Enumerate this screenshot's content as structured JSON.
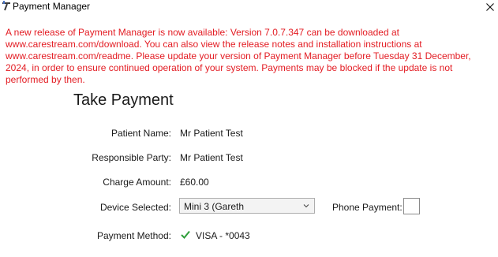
{
  "window": {
    "title": "Payment Manager",
    "app_icon": "payment-manager-app-icon",
    "close_icon": "close-icon"
  },
  "warning": {
    "message": "A new release of Payment Manager is now available: Version 7.0.7.347 can be downloaded at www.carestream.com/download. You can also view the release notes and installation instructions at www.carestream.com/readme. Please update your version of Payment Manager before Tuesday 31 December, 2024, in order to ensure continued operation of your system. Payments may be blocked if the update is not performed by then.",
    "color": "#e31c23"
  },
  "form": {
    "heading": "Take Payment",
    "patient_name": {
      "label": "Patient Name:",
      "value": "Mr Patient Test"
    },
    "responsible_party": {
      "label": "Responsible Party:",
      "value": "Mr Patient Test"
    },
    "charge_amount": {
      "label": "Charge Amount:",
      "value": "£60.00"
    },
    "device_selected": {
      "label": "Device Selected:",
      "value": "Mini 3 (Gareth",
      "icon": "chevron-down-icon"
    },
    "phone_payment": {
      "label": "Phone Payment:",
      "checked": false
    },
    "payment_method": {
      "label": "Payment Method:",
      "value": "VISA - *0043",
      "icon": "checkmark-icon",
      "icon_color": "#2e9e3a"
    }
  }
}
